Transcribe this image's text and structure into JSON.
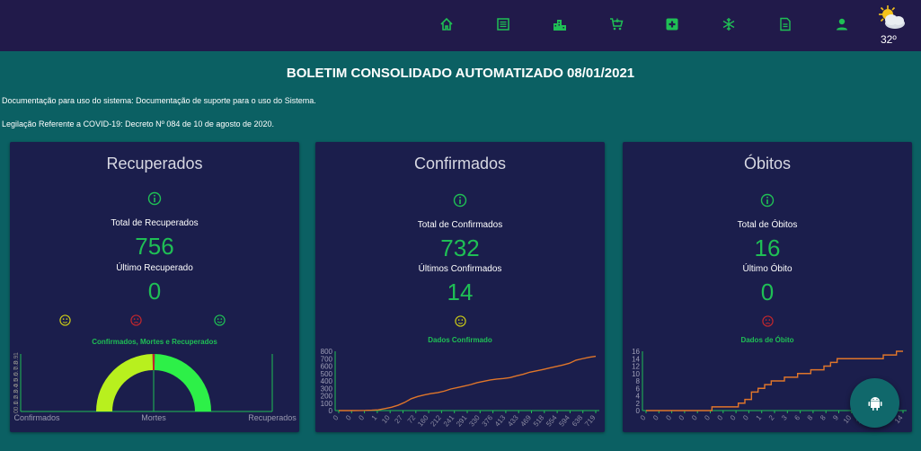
{
  "nav": {
    "icons": [
      "home-icon",
      "list-icon",
      "city-icon",
      "cart-icon",
      "medical-plus-icon",
      "snowflake-icon",
      "document-icon",
      "person-icon"
    ],
    "weather_icon": "partly-sunny-icon",
    "temperature": "32º"
  },
  "header": {
    "title": "BOLETIM CONSOLIDADO AUTOMATIZADO 08/01/2021"
  },
  "links": {
    "documentation": "Documentação para uso do sistema: Documentação de suporte para o uso do Sistema.",
    "legislation": "Legilação Referente a COVID-19: Decreto Nº 084 de 10 de agosto de 2020."
  },
  "colors": {
    "topbar": "#211a4a",
    "background": "#0b6063",
    "card": "#1b1e4c",
    "value_green": "#1fbf55",
    "line_orange": "#e0762a",
    "face_yellow": "#c8c816",
    "face_red": "#c1272d",
    "face_green": "#1fbf55",
    "gauge_lime": "#b8f01e",
    "gauge_green": "#2df048"
  },
  "cards": [
    {
      "title": "Recuperados",
      "total_label": "Total de Recuperados",
      "total_value": "756",
      "last_label": "Último Recuperado",
      "last_value": "0",
      "faces": [
        "neutral-face-icon",
        "sad-face-icon",
        "happy-face-icon"
      ],
      "chart_caption": "Confirmados, Mortes e Recuperados"
    },
    {
      "title": "Confirmados",
      "total_label": "Total de Confirmados",
      "total_value": "732",
      "last_label": "Últimos Confirmados",
      "last_value": "14",
      "faces": [
        "neutral-face-icon"
      ],
      "chart_caption": "Dados Confirmado"
    },
    {
      "title": "Óbitos",
      "total_label": "Total de Óbitos",
      "total_value": "16",
      "last_label": "Último Óbito",
      "last_value": "0",
      "faces": [
        "sad-face-icon"
      ],
      "chart_caption": "Dados de Óbito"
    }
  ],
  "chart_data": [
    {
      "type": "gauge",
      "categories": [
        "Confirmados",
        "Mortes",
        "Recuperados"
      ],
      "y_ticks": [
        "1",
        "0.9",
        "0.8",
        "0.7",
        "0.6",
        "0.5",
        "0.4",
        "0.3",
        "0.2",
        "0.1",
        "0"
      ],
      "ylim": [
        0,
        1
      ]
    },
    {
      "type": "line",
      "ylim": [
        0,
        800
      ],
      "y_ticks": [
        "800",
        "700",
        "600",
        "500",
        "400",
        "300",
        "200",
        "100",
        "0"
      ],
      "x_ticks": [
        "0",
        "0",
        "0",
        "1",
        "10",
        "27",
        "72",
        "160",
        "212",
        "241",
        "291",
        "330",
        "376",
        "413",
        "433",
        "469",
        "518",
        "554",
        "594",
        "638",
        "719"
      ],
      "values": [
        0,
        0,
        0,
        1,
        2,
        5,
        10,
        27,
        45,
        72,
        110,
        160,
        190,
        212,
        230,
        241,
        262,
        291,
        310,
        330,
        350,
        376,
        395,
        413,
        425,
        433,
        445,
        469,
        490,
        518,
        535,
        554,
        575,
        594,
        615,
        638,
        680,
        700,
        719,
        732
      ]
    },
    {
      "type": "line",
      "ylim": [
        0,
        16
      ],
      "y_ticks": [
        "16",
        "14",
        "12",
        "10",
        "8",
        "6",
        "4",
        "2",
        "0"
      ],
      "x_ticks": [
        "0",
        "0",
        "0",
        "0",
        "0",
        "0",
        "0",
        "0",
        "0",
        "1",
        "2",
        "3",
        "6",
        "8",
        "8",
        "9",
        "10",
        "14",
        "14",
        "14",
        "14"
      ],
      "values": [
        0,
        0,
        0,
        0,
        0,
        0,
        0,
        0,
        0,
        0,
        1,
        1,
        1,
        1,
        2,
        3,
        5,
        6,
        7,
        8,
        8,
        9,
        9,
        10,
        10,
        11,
        11,
        12,
        13,
        14,
        14,
        14,
        14,
        14,
        14,
        14,
        15,
        15,
        16,
        16
      ]
    }
  ]
}
